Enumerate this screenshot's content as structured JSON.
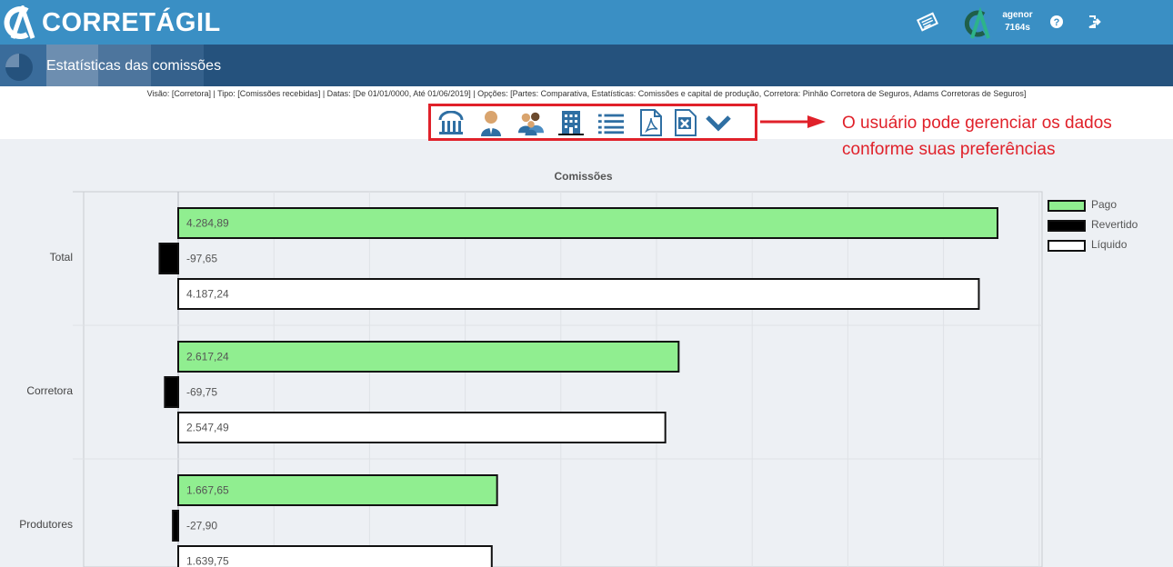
{
  "app": {
    "brand": "CORRETÁGIL",
    "user_name": "agenor",
    "user_code": "7164s",
    "icons": [
      "newspaper-icon",
      "help-icon",
      "logout-icon"
    ]
  },
  "page": {
    "title": "Estatísticas das comissões",
    "filters": "Visão: [Corretora] | Tipo: [Comissões recebidas] | Datas: [De 01/01/0000, Até 01/06/2019] | Opções: [Partes: Comparativa, Estatísticas: Comissões e capital de produção, Corretora: Pinhão Corretora de Seguros, Adams Corretoras de Seguros]"
  },
  "toolbar": {
    "icons": [
      "bank-icon",
      "person-icon",
      "group-icon",
      "building-icon",
      "list-icon",
      "pdf-icon",
      "excel-icon",
      "chevron-down-icon"
    ]
  },
  "annotation": {
    "line1": "O usuário pode gerenciar os dados",
    "line2": "conforme suas preferências",
    "color": "#e0212a"
  },
  "chart_data": {
    "type": "bar",
    "orientation": "horizontal",
    "title": "Comissões",
    "categories": [
      "Total",
      "Corretora",
      "Produtores"
    ],
    "series": [
      {
        "name": "Pago",
        "values": [
          4284.89,
          2617.24,
          1667.65
        ],
        "labels": [
          "4.284,89",
          "2.617,24",
          "1.667,65"
        ],
        "color": "#90ee90"
      },
      {
        "name": "Revertido",
        "values": [
          -97.65,
          -69.75,
          -27.9
        ],
        "labels": [
          "-97,65",
          "-69,75",
          "-27,90"
        ],
        "color": "#000000"
      },
      {
        "name": "Líquido",
        "values": [
          4187.24,
          2547.49,
          1639.75
        ],
        "labels": [
          "4.187,24",
          "2.547,49",
          "1.639,75"
        ],
        "color": "#ffffff"
      }
    ],
    "legend_position": "right",
    "grid": true
  }
}
